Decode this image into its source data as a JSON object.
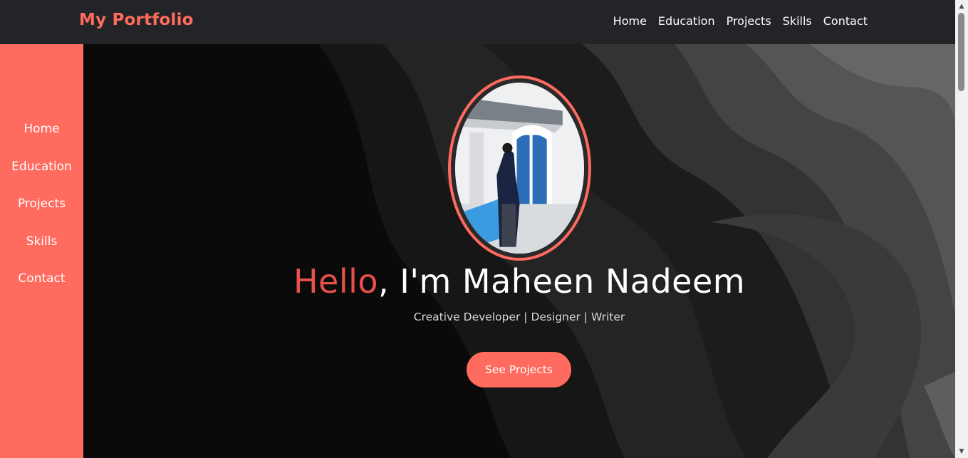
{
  "brand": "My Portfolio",
  "topnav": [
    "Home",
    "Education",
    "Projects",
    "Skills",
    "Contact"
  ],
  "sidenav": [
    "Home",
    "Education",
    "Projects",
    "Skills",
    "Contact"
  ],
  "hero": {
    "greeting": "Hello",
    "name_line": ", I'm Maheen Nadeem",
    "tagline": "Creative Developer | Designer | Writer",
    "cta": "See Projects"
  },
  "colors": {
    "accent": "#ff6b5e",
    "greeting": "#e8514a",
    "navbar": "#222427",
    "background": "#0a0a0a"
  }
}
